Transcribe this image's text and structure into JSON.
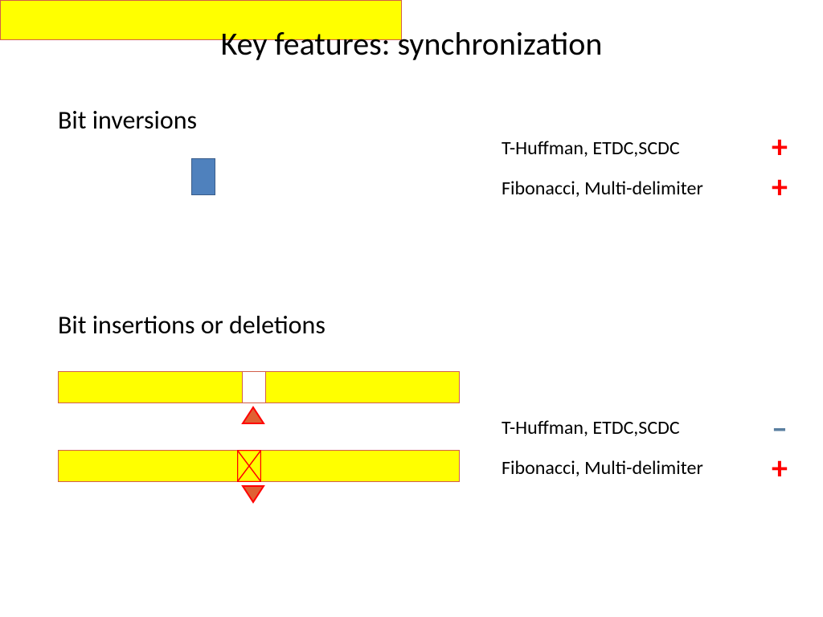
{
  "title": "Key features: synchronization",
  "sections": {
    "inversions": {
      "heading": "Bit inversions",
      "legend": [
        {
          "label": "T-Huffman, ETDC,SCDC",
          "symbol": "+"
        },
        {
          "label": "Fibonacci, Multi-delimiter",
          "symbol": "+"
        }
      ]
    },
    "insdel": {
      "heading": "Bit insertions or deletions",
      "legend": [
        {
          "label": "T-Huffman, ETDC,SCDC",
          "symbol": "–"
        },
        {
          "label": "Fibonacci, Multi-delimiter",
          "symbol": "+"
        }
      ]
    }
  }
}
